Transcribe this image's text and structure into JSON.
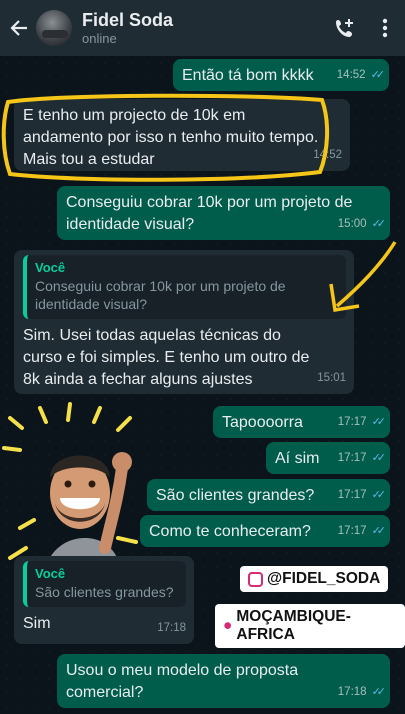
{
  "header": {
    "contact_name": "Fidel Soda",
    "status": "online"
  },
  "messages": [
    {
      "dir": "out",
      "text": "Então tá bom kkkk",
      "time": "14:52"
    },
    {
      "dir": "in",
      "text": "E tenho um projecto de 10k em andamento por isso n tenho muito tempo. Mais tou a estudar",
      "time": "14:52"
    },
    {
      "dir": "out",
      "text": "Conseguiu cobrar 10k por um projeto de identidade visual?",
      "time": "15:00"
    },
    {
      "dir": "in",
      "quote_author": "Você",
      "quote_text": "Conseguiu cobrar 10k por um projeto de identidade visual?",
      "text": "Sim. Usei todas aquelas técnicas do curso e foi simples. E tenho um outro de 8k ainda a fechar alguns ajustes",
      "time": "15:01"
    },
    {
      "dir": "out",
      "text": "Tapoooorra",
      "time": "17:17"
    },
    {
      "dir": "out",
      "text": "Aí sim",
      "time": "17:17"
    },
    {
      "dir": "out",
      "text": "São clientes grandes?",
      "time": "17:17"
    },
    {
      "dir": "out",
      "text": "Como te conheceram?",
      "time": "17:17"
    },
    {
      "dir": "in",
      "quote_author": "Você",
      "quote_text": "São clientes grandes?",
      "text": "Sim",
      "time": "17:18"
    },
    {
      "dir": "out",
      "text": "Usou o meu modelo de proposta comercial?",
      "time": "17:18"
    }
  ],
  "overlay_tags": {
    "instagram": "@FIDEL_SODA",
    "location": "MOÇAMBIQUE-AFRICA"
  },
  "colors": {
    "outgoing_bubble": "#005c4b",
    "incoming_bubble": "#1f2c34",
    "highlight": "#f5c518",
    "read_ticks": "#53bdeb"
  },
  "icons": [
    "back-arrow-icon",
    "add-call-icon",
    "more-vert-icon",
    "double-check-icon",
    "instagram-icon",
    "location-pin-icon"
  ]
}
